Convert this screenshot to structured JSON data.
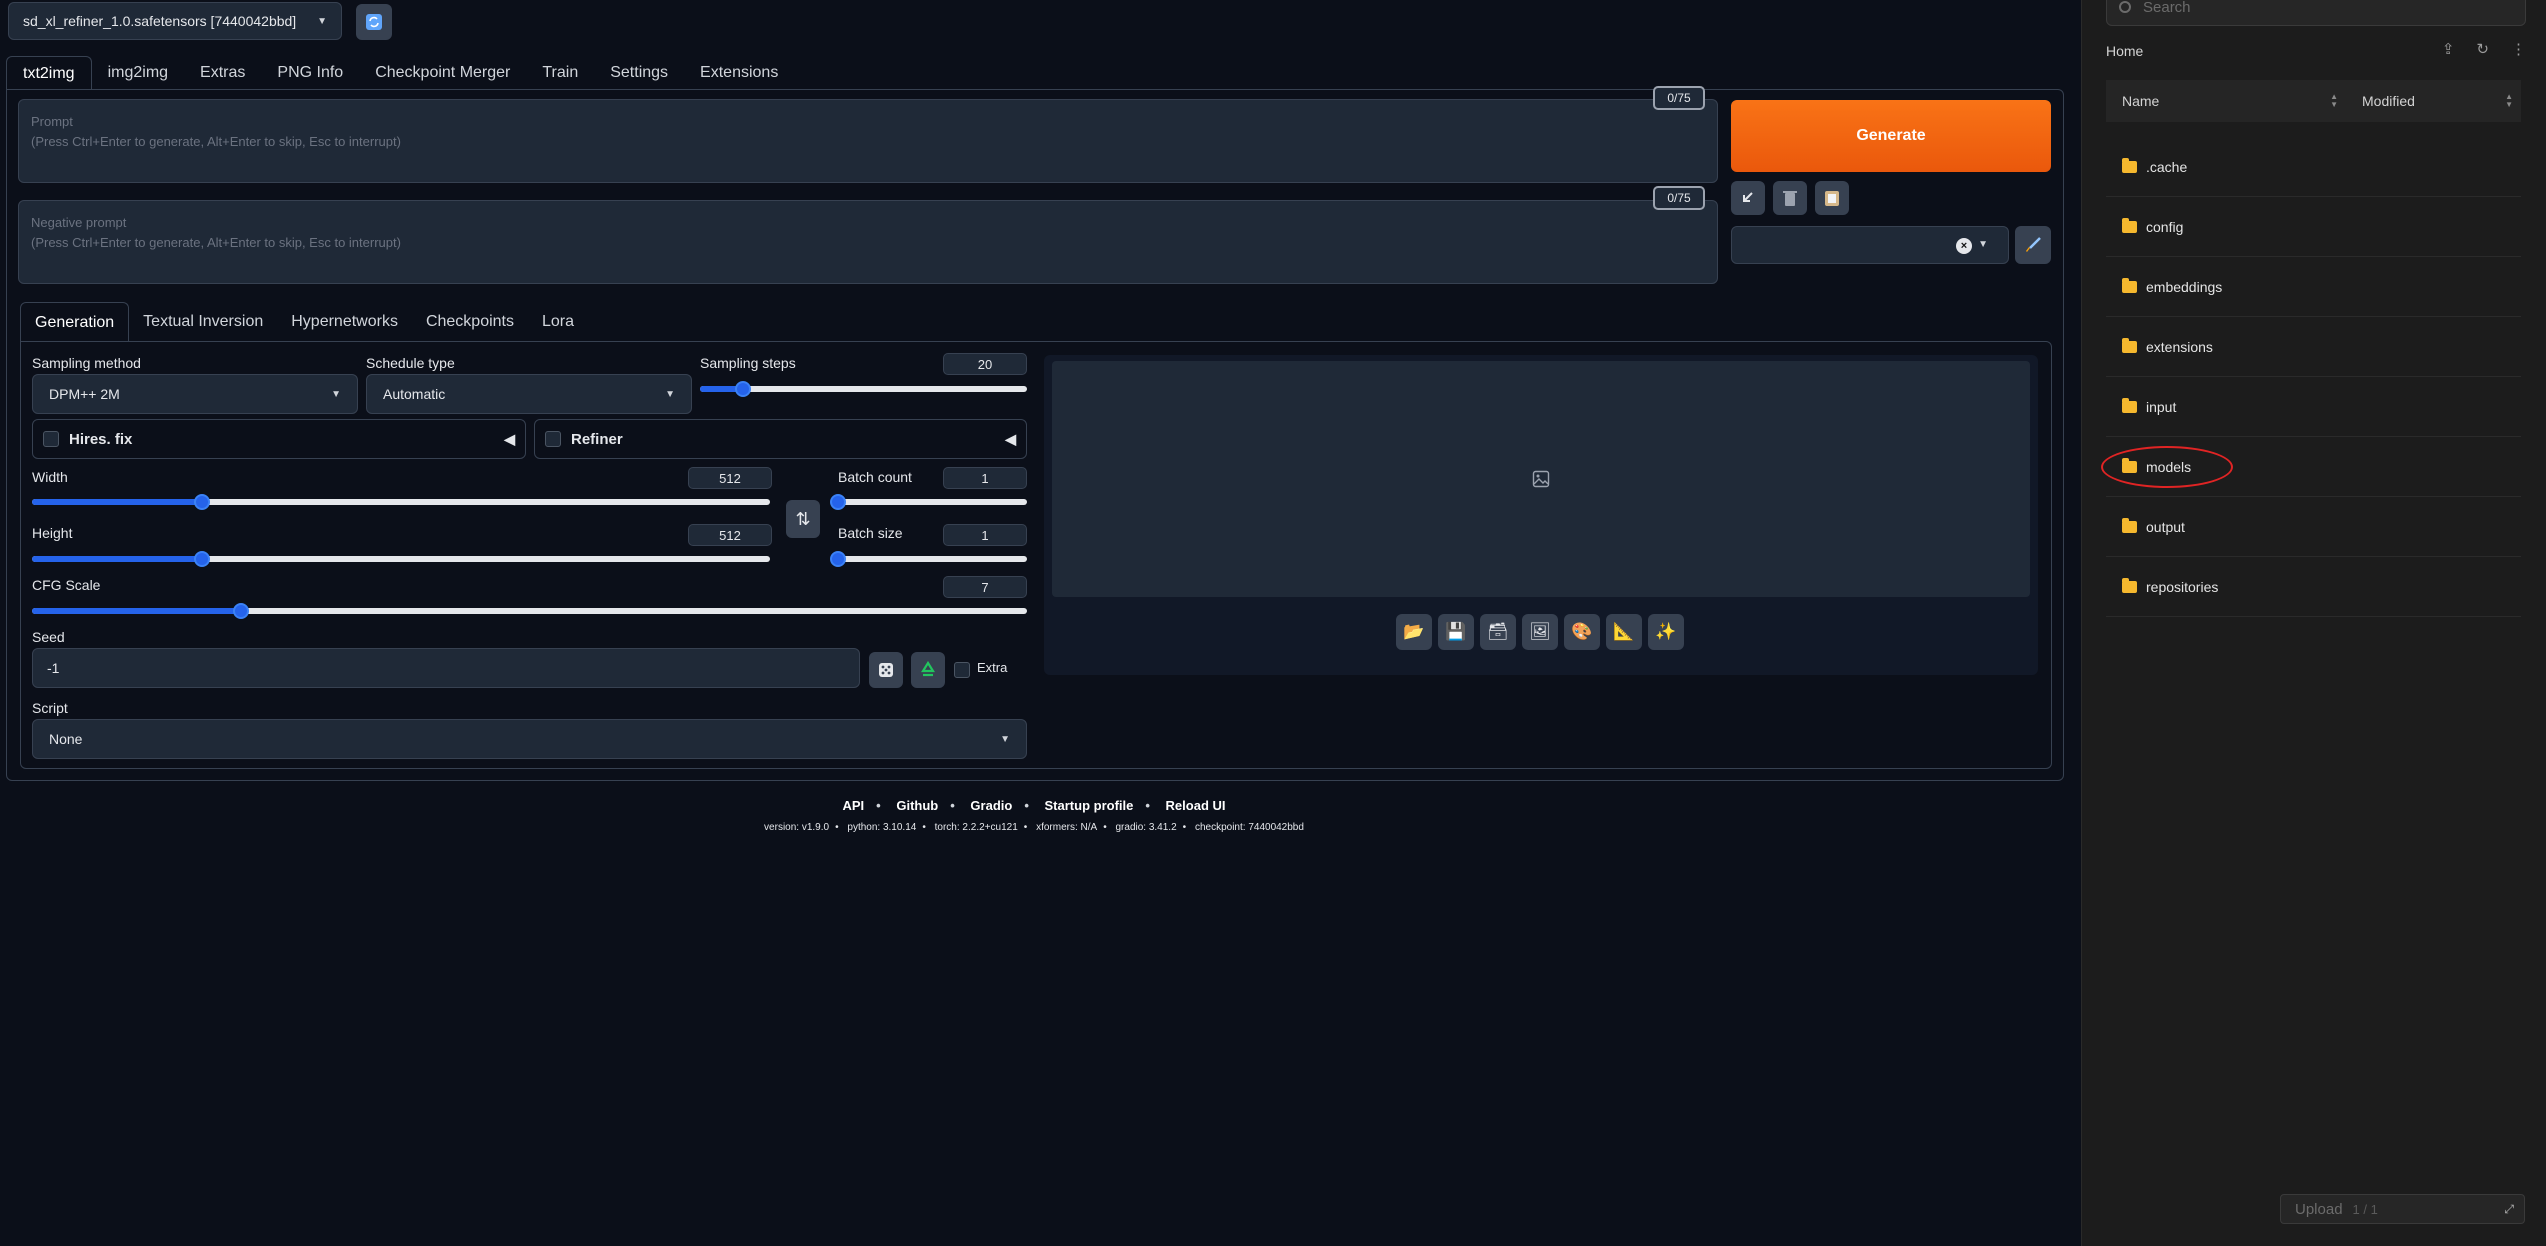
{
  "checkpoint": {
    "selected": "sd_xl_refiner_1.0.safetensors [7440042bbd]"
  },
  "top_tabs": [
    "txt2img",
    "img2img",
    "Extras",
    "PNG Info",
    "Checkpoint Merger",
    "Train",
    "Settings",
    "Extensions"
  ],
  "prompt": {
    "label": "Prompt",
    "placeholder": "(Press Ctrl+Enter to generate, Alt+Enter to skip, Esc to interrupt)",
    "token_count": "0/75"
  },
  "negative_prompt": {
    "label": "Negative prompt",
    "placeholder": "(Press Ctrl+Enter to generate, Alt+Enter to skip, Esc to interrupt)",
    "token_count": "0/75"
  },
  "generate_label": "Generate",
  "sub_tabs": [
    "Generation",
    "Textual Inversion",
    "Hypernetworks",
    "Checkpoints",
    "Lora"
  ],
  "sampling": {
    "method_label": "Sampling method",
    "method_value": "DPM++ 2M",
    "schedule_label": "Schedule type",
    "schedule_value": "Automatic",
    "steps_label": "Sampling steps",
    "steps_value": "20",
    "steps_fraction": 0.13
  },
  "hires_label": "Hires. fix",
  "refiner_label": "Refiner",
  "width": {
    "label": "Width",
    "value": "512",
    "fraction": 0.23
  },
  "height": {
    "label": "Height",
    "value": "512",
    "fraction": 0.23
  },
  "batch_count": {
    "label": "Batch count",
    "value": "1",
    "fraction": 0.0
  },
  "batch_size": {
    "label": "Batch size",
    "value": "1",
    "fraction": 0.0
  },
  "cfg": {
    "label": "CFG Scale",
    "value": "7",
    "fraction": 0.21
  },
  "seed": {
    "label": "Seed",
    "value": "-1",
    "extra_label": "Extra"
  },
  "script": {
    "label": "Script",
    "value": "None"
  },
  "footer": {
    "links": [
      "API",
      "Github",
      "Gradio",
      "Startup profile",
      "Reload UI"
    ],
    "version": [
      "version: v1.9.0",
      "python: 3.10.14",
      "torch: 2.2.2+cu121",
      "xformers: N/A",
      "gradio: 3.41.2",
      "checkpoint: 7440042bbd"
    ]
  },
  "file_panel": {
    "search_placeholder": "Search",
    "breadcrumb": "Home",
    "columns": [
      "Name",
      "Modified"
    ],
    "folders": [
      ".cache",
      "config",
      "embeddings",
      "extensions",
      "input",
      "models",
      "output",
      "repositories"
    ],
    "highlighted_folder": "models",
    "upload_label": "Upload",
    "upload_count": "1 / 1"
  },
  "colors": {
    "accent": "#f97316",
    "slider": "#2563eb",
    "highlight": "#e02424"
  }
}
